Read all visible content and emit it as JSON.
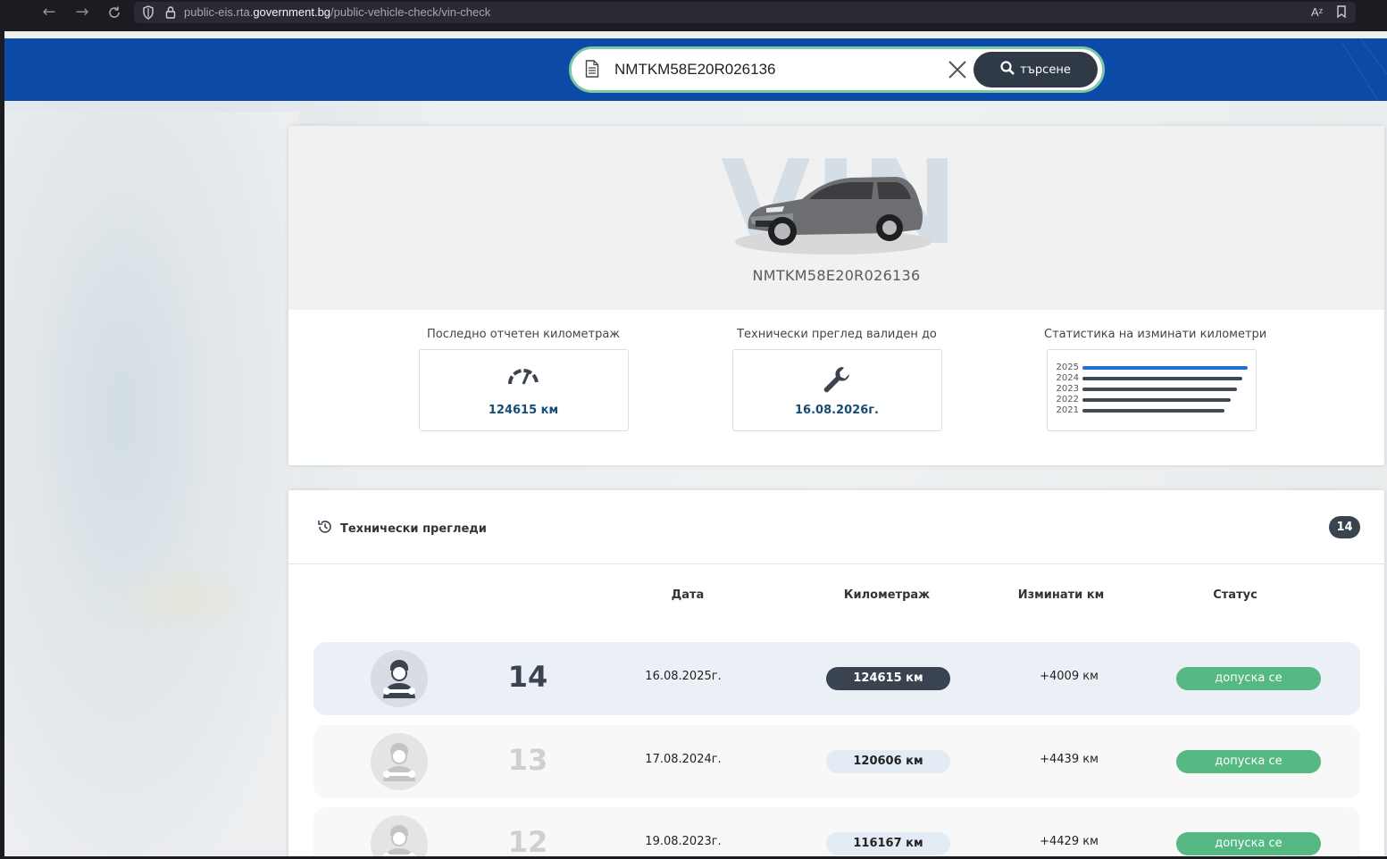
{
  "browser": {
    "url_prefix": "public-eis.rta.",
    "url_domain": "government.bg",
    "url_path": "/public-vehicle-check/vin-check"
  },
  "search": {
    "value": "NMTKM58E20R026136",
    "button_label": "търсене"
  },
  "vehicle": {
    "watermark": "VIN",
    "vin": "NMTKM58E20R026136",
    "stats": {
      "mileage_label": "Последно отчетен километраж",
      "mileage_value": "124615 км",
      "inspection_label": "Технически преглед валиден до",
      "inspection_value": "16.08.2026г.",
      "km_stats_label": "Статистика на изминати километри",
      "km_years": [
        {
          "year": "2025",
          "level": 1.0,
          "color": "#1f6fd6"
        },
        {
          "year": "2024",
          "level": 0.97,
          "color": "#3f4a56"
        },
        {
          "year": "2023",
          "level": 0.94,
          "color": "#3f4a56"
        },
        {
          "year": "2022",
          "level": 0.9,
          "color": "#3f4a56"
        },
        {
          "year": "2021",
          "level": 0.86,
          "color": "#3f4a56"
        }
      ]
    }
  },
  "inspections": {
    "title": "Технически прегледи",
    "count": "14",
    "columns": {
      "date": "Дата",
      "mileage": "Километраж",
      "traveled": "Изминати км",
      "status": "Статус"
    },
    "rows": [
      {
        "number": "14",
        "date": "16.08.2025г.",
        "mileage": "124615 км",
        "traveled": "+4009 км",
        "status": "допуска се",
        "active": true
      },
      {
        "number": "13",
        "date": "17.08.2024г.",
        "mileage": "120606 км",
        "traveled": "+4439 км",
        "status": "допуска се",
        "active": false
      },
      {
        "number": "12",
        "date": "19.08.2023г.",
        "mileage": "116167 км",
        "traveled": "+4429 км",
        "status": "допуска се",
        "active": false
      }
    ]
  },
  "colors": {
    "header_blue": "#0b4aa6",
    "status_green": "#56b882",
    "dark_pill": "#3a4450",
    "accent_teal": "#164d72"
  }
}
